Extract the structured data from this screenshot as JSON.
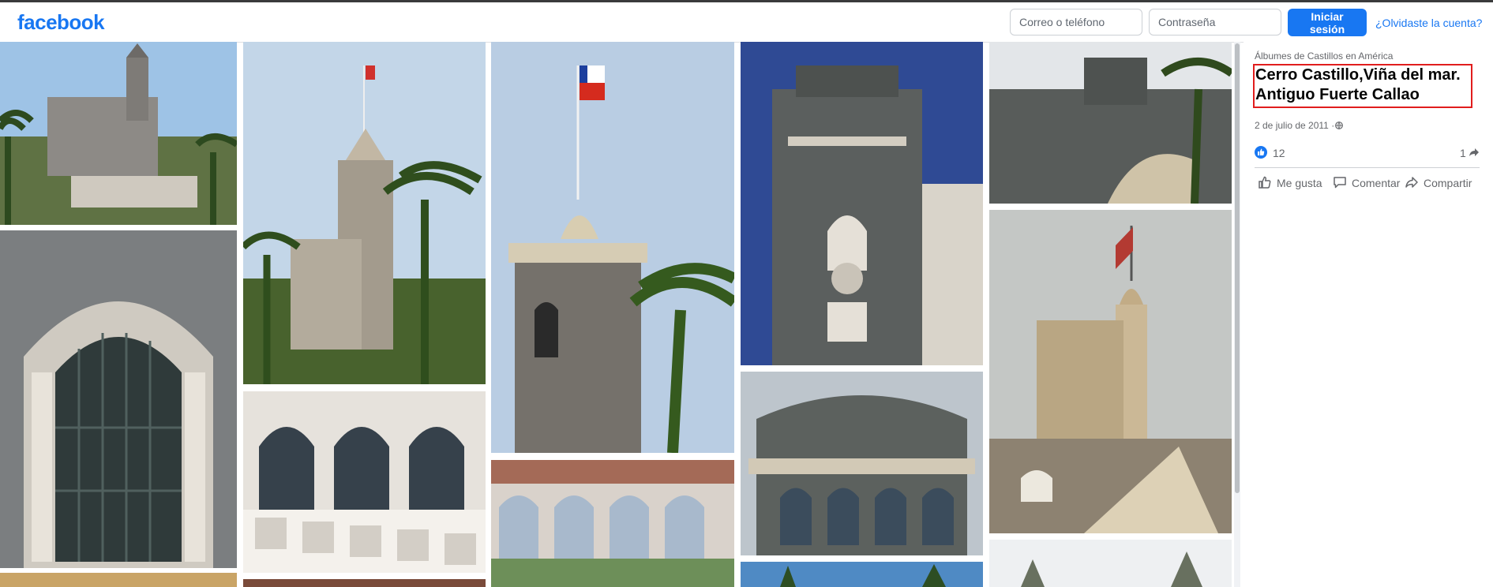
{
  "header": {
    "logo": "facebook",
    "email_placeholder": "Correo o teléfono",
    "password_placeholder": "Contraseña",
    "login_label": "Iniciar sesión",
    "forgot_label": "¿Olvidaste la cuenta?"
  },
  "post": {
    "album": "Álbumes de Castillos en América",
    "title_line1": "Cerro Castillo,Viña del mar.",
    "title_line2": "Antiguo Fuerte Callao",
    "date": "2 de julio de 2011 ·",
    "likes": "12",
    "shares": "1",
    "actions": {
      "like": "Me gusta",
      "comment": "Comentar",
      "share": "Compartir"
    }
  },
  "icons": [
    "globe-icon",
    "like-reaction-icon",
    "share-count-icon",
    "thumbs-up-icon",
    "comment-icon",
    "share-icon"
  ],
  "colors": {
    "brand": "#1877f2",
    "highlight": "#e11d1d"
  }
}
